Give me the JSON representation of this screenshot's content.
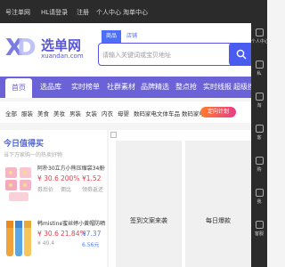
{
  "topbar": {
    "links": [
      "号注单网",
      "HL请登录",
      "注册",
      "个人中心",
      "淘单中心"
    ]
  },
  "brand": {
    "name": "选单网",
    "domain": "xuandan.com",
    "accent": "#5856d6"
  },
  "search": {
    "tabs": [
      "商品",
      "店铺"
    ],
    "placeholder": "请输入关键词或宝贝地址"
  },
  "nav": {
    "items": [
      "首页",
      "选品库",
      "实时榜单",
      "社群素材",
      "品牌精选",
      "整点抢",
      "实时线报",
      "超级搜"
    ],
    "active_index": 0,
    "color": "#6b62d8"
  },
  "categories": {
    "items": [
      "全部",
      "服装",
      "美食",
      "美妆",
      "男装",
      "女装",
      "内衣",
      "母婴",
      "数码家电",
      "文体车品",
      "数码家电"
    ],
    "badge": "定向计划"
  },
  "daily": {
    "title": "今日值得买",
    "subtitle": "当下万家购一的热卖好物",
    "items": [
      {
        "title": "阿朴30立方小熊压缩袋34册*2...",
        "price": "¥ 30.6",
        "old_price": "券后价",
        "percent": "200%",
        "percent_label": "佣比",
        "rebate": "¥1.52",
        "rebate_label": "领券返还"
      },
      {
        "title": "韩mistine蜜丝婷小黄帽防晒霜40m",
        "price": "¥ 30.6",
        "old_price": "¥ 40.4",
        "percent": "21.84%",
        "percent_label": "",
        "rebate": "¥7.37",
        "rebate_label": "6.56元"
      }
    ]
  },
  "banner": {
    "cards": [
      "签到文案来袭",
      "每日爆款"
    ]
  },
  "side": {
    "items": [
      "个人中心",
      "私",
      "淘",
      "客",
      "购",
      "我",
      "客服"
    ]
  }
}
